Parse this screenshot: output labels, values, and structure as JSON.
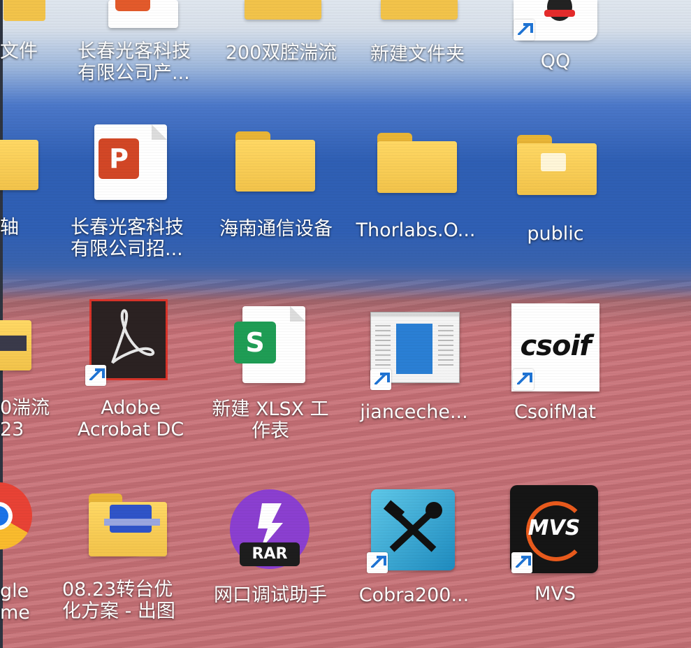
{
  "desktop": {
    "row1": {
      "partial_left": "文件",
      "item2": "长春光客科技\n有限公司产...",
      "item3": "200双腔湍流",
      "item4": "新建文件夹",
      "item5": "QQ"
    },
    "row2": {
      "partial_left": "轴",
      "item2": "长春光客科技\n有限公司招...",
      "item3": "海南通信设备",
      "item4": "Thorlabs.O...",
      "item5": "public",
      "ppt_letter": "P"
    },
    "row3": {
      "partial_left": "0湍流\n23",
      "item2": "Adobe\nAcrobat DC",
      "item3": "新建 XLSX 工\n作表",
      "item4": "jianceche...",
      "item5": "CsoifMat",
      "xlsx_letter": "S",
      "csoif_logo": "csoif"
    },
    "row4": {
      "partial_left": "gle\nme",
      "item2": "08.23转台优\n化方案 - 出图",
      "item3": "网口调试助手",
      "item4": "Cobra200...",
      "item5": "MVS",
      "rar_badge": "RAR",
      "mvs_logo": "MVS"
    }
  },
  "colors": {
    "folder": "#f2c34a",
    "ppt": "#d24726",
    "xlsx": "#1f9d55",
    "shortcut_arrow": "#1f74d4",
    "rar": "#8b3fd0"
  }
}
